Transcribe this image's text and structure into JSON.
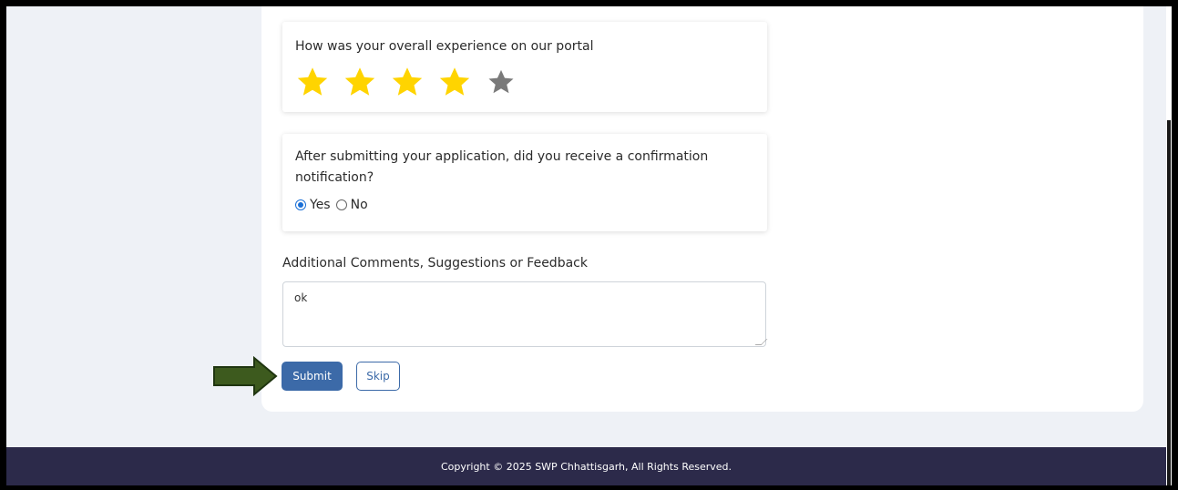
{
  "questions": {
    "experience": {
      "text": "How was your overall experience on our portal",
      "rating": 4,
      "max_rating": 5,
      "star_color_filled": "#ffd400",
      "star_color_empty": "#7a7a7a"
    },
    "confirmation": {
      "text": "After submitting your application, did you receive a confirmation notification?",
      "options": [
        "Yes",
        "No"
      ],
      "selected": "Yes"
    }
  },
  "comments": {
    "label": "Additional Comments, Suggestions or Feedback",
    "value": "ok"
  },
  "buttons": {
    "submit_label": "Submit",
    "skip_label": "Skip"
  },
  "annotation": {
    "arrow_color": "#3d5a1e"
  },
  "footer": {
    "copyright": "Copyright © 2025 SWP Chhattisgarh, All Rights Reserved."
  },
  "colors": {
    "primary": "#3c6aa8",
    "footer_bg": "#2c2a4a",
    "page_bg": "#eef1f6"
  }
}
